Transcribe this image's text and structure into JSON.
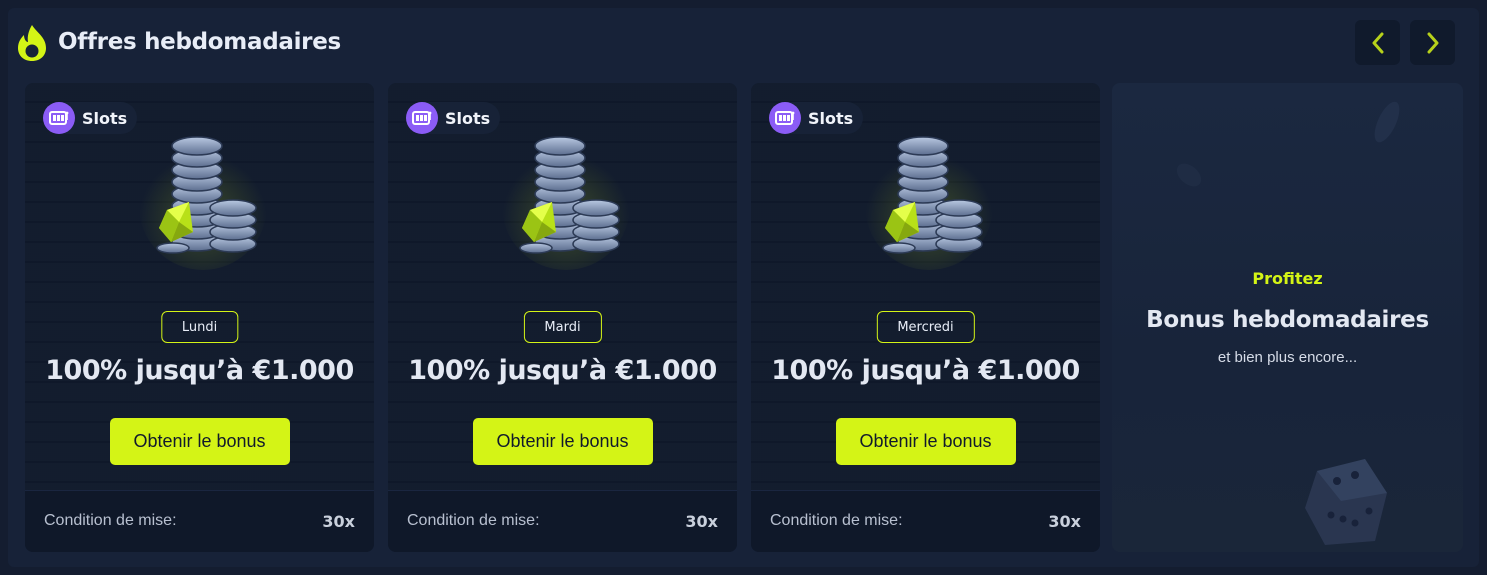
{
  "header": {
    "title": "Offres hebdomadaires",
    "prev_icon": "chevron-left-icon",
    "next_icon": "chevron-right-icon"
  },
  "offers": [
    {
      "category": "Slots",
      "category_icon": "slot-machine-icon",
      "day": "Lundi",
      "offer": "100% jusqu’à €1.000",
      "button": "Obtenir le bonus",
      "wager_label": "Condition de mise:",
      "wager_value": "30x"
    },
    {
      "category": "Slots",
      "category_icon": "slot-machine-icon",
      "day": "Mardi",
      "offer": "100% jusqu’à €1.000",
      "button": "Obtenir le bonus",
      "wager_label": "Condition de mise:",
      "wager_value": "30x"
    },
    {
      "category": "Slots",
      "category_icon": "slot-machine-icon",
      "day": "Mercredi",
      "offer": "100% jusqu’à €1.000",
      "button": "Obtenir le bonus",
      "wager_label": "Condition de mise:",
      "wager_value": "30x"
    }
  ],
  "promo": {
    "eyebrow": "Profitez",
    "title": "Bonus hebdomadaires",
    "subtitle": "et bien plus encore..."
  },
  "colors": {
    "accent": "#d4f416",
    "category": "#8b5cf6",
    "background": "#141d30",
    "card": "#101a2c"
  }
}
